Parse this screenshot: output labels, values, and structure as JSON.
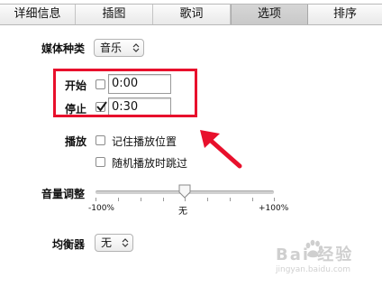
{
  "tabs": [
    {
      "label": "详细信息",
      "selected": false
    },
    {
      "label": "插图",
      "selected": false
    },
    {
      "label": "歌词",
      "selected": false
    },
    {
      "label": "选项",
      "selected": true
    },
    {
      "label": "排序",
      "selected": false
    }
  ],
  "media_kind": {
    "label": "媒体种类",
    "value": "音乐"
  },
  "start": {
    "label": "开始",
    "checked": false,
    "value": "0:00"
  },
  "stop": {
    "label": "停止",
    "checked": true,
    "value": "0:30"
  },
  "playback": {
    "label": "播放",
    "remember_position": {
      "label": "记住播放位置",
      "checked": false
    },
    "skip_shuffle": {
      "label": "随机播放时跳过",
      "checked": false
    }
  },
  "volume": {
    "label": "音量调整",
    "min_label": "-100%",
    "center_label": "无",
    "max_label": "+100%",
    "value_percent": 0
  },
  "equalizer": {
    "label": "均衡器",
    "value": "无"
  },
  "watermark": {
    "text": "Bai 经验",
    "sub": "jingyan.baidu.com"
  },
  "colors": {
    "highlight_box": "#e8102c",
    "annotation_arrow": "#e8102c"
  },
  "icons": [
    "updown-arrows-icon",
    "checkmark-icon",
    "red-arrow-icon",
    "baidu-paw-icon"
  ]
}
